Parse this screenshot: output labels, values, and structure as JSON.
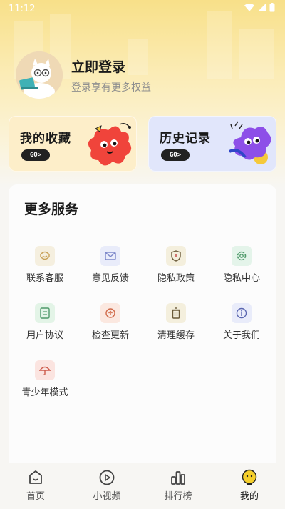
{
  "status_bar": {
    "time": "11:12"
  },
  "profile": {
    "title": "立即登录",
    "subtitle": "登录享有更多权益"
  },
  "cards": [
    {
      "title": "我的收藏",
      "go": "GO>"
    },
    {
      "title": "历史记录",
      "go": "GO>"
    }
  ],
  "services": {
    "title": "更多服务",
    "items": [
      {
        "label": "联系客服",
        "icon": "customer-service-icon"
      },
      {
        "label": "意见反馈",
        "icon": "mail-icon"
      },
      {
        "label": "隐私政策",
        "icon": "shield-icon"
      },
      {
        "label": "隐私中心",
        "icon": "gear-icon"
      },
      {
        "label": "用户协议",
        "icon": "document-icon"
      },
      {
        "label": "检查更新",
        "icon": "update-icon"
      },
      {
        "label": "清理缓存",
        "icon": "trash-icon"
      },
      {
        "label": "关于我们",
        "icon": "info-icon"
      },
      {
        "label": "青少年模式",
        "icon": "umbrella-icon"
      }
    ]
  },
  "tabbar": {
    "active": "我的",
    "items": [
      {
        "label": "首页",
        "icon": "home-icon"
      },
      {
        "label": "小视频",
        "icon": "play-icon"
      },
      {
        "label": "排行榜",
        "icon": "ranking-icon"
      },
      {
        "label": "我的",
        "icon": "profile-icon"
      }
    ]
  },
  "colors": {
    "hero_yellow": "#f8e089",
    "fav_card": "#fdeec9",
    "history_card": "#e1e6fb",
    "active_tab": "#f5cf2b"
  }
}
